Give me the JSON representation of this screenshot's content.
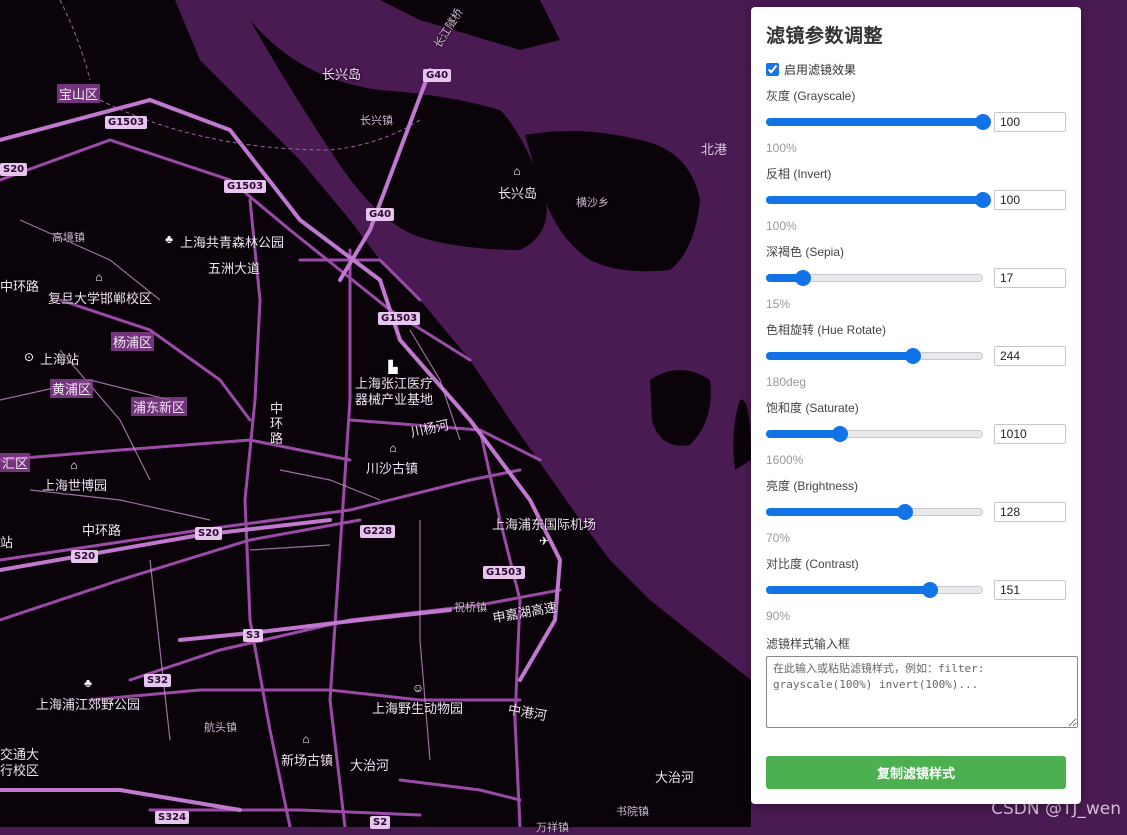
{
  "map": {
    "labels": {
      "changxing_island": "长兴岛",
      "changxing_town": "长兴镇",
      "changxing_island_poi": "长兴岛",
      "hengsha": "横沙乡",
      "beigang": "北港",
      "gaojing": "高境镇",
      "gongqing_park": "上海共青森林公园",
      "wuzhou_road": "五洲大道",
      "zhonghuan_1": "中环路",
      "fudan_handan": "复旦大学邯郸校区",
      "shanghai_station": "上海站",
      "zhangjiang_medical": "上海张江医疗\n器械产业基地",
      "zhonghuan_vertical": "中\n环\n路",
      "chuanyang_river": "川杨河",
      "chuansha": "川沙古镇",
      "shibo": "上海世博园",
      "zhonghuan_2": "中环路",
      "pudong_airport": "上海浦东国际机场",
      "zhuqiao": "祝桥镇",
      "shenjiahu": "申嘉湖高速",
      "pujiang_park": "上海浦江郊野公园",
      "hangtou": "航头镇",
      "wildlife_park": "上海野生动物园",
      "xingang_river": "中港河",
      "xinchang": "新场古镇",
      "dazhi_river_1": "大治河",
      "dazhi_river_2": "大治河",
      "shuyuan": "书院镇",
      "wanxiang": "万祥镇",
      "jiaoda": "交通大\n行校区",
      "huabei_station": "站",
      "changjiang_tunnel": "长江隧桥"
    },
    "districts": {
      "baoshan": "宝山区",
      "yangpu": "杨浦区",
      "huangpu": "黄浦区",
      "pudong": "浦东新区",
      "xuhui_edge": "汇区"
    },
    "shields": {
      "g1503_a": "G1503",
      "g1503_b": "G1503",
      "g1503_c": "G1503",
      "g1503_d": "G1503",
      "g40_a": "G40",
      "g40_b": "G40",
      "s20_a": "S20",
      "s20_b": "S20",
      "s20_c": "S20",
      "g228": "G228",
      "s3": "S3",
      "s32": "S32",
      "s324": "S324",
      "s2": "S2"
    },
    "watermark": "CSDN @TJ_wen"
  },
  "panel": {
    "title": "滤镜参数调整",
    "enable_label": "启用滤镜效果",
    "enable_checked": true,
    "filters": [
      {
        "label": "灰度 (Grayscale)",
        "input": "100",
        "value_text": "100%",
        "slider_fraction": 1.0
      },
      {
        "label": "反相 (Invert)",
        "input": "100",
        "value_text": "100%",
        "slider_fraction": 1.0
      },
      {
        "label": "深褐色 (Sepia)",
        "input": "17",
        "value_text": "15%",
        "slider_fraction": 0.17
      },
      {
        "label": "色相旋转 (Hue Rotate)",
        "input": "244",
        "value_text": "180deg",
        "slider_fraction": 0.678
      },
      {
        "label": "饱和度 (Saturate)",
        "input": "1010",
        "value_text": "1600%",
        "slider_fraction": 0.34
      },
      {
        "label": "亮度 (Brightness)",
        "input": "128",
        "value_text": "70%",
        "slider_fraction": 0.64
      },
      {
        "label": "对比度 (Contrast)",
        "input": "151",
        "value_text": "90%",
        "slider_fraction": 0.755
      }
    ],
    "textarea_label": "滤镜样式输入框",
    "textarea_placeholder": "在此输入或粘贴滤镜样式，例如：filter: grayscale(100%) invert(100%)...",
    "copy_button": "复制滤镜样式",
    "accent_color": "#1173e6",
    "button_color": "#4caf50"
  }
}
